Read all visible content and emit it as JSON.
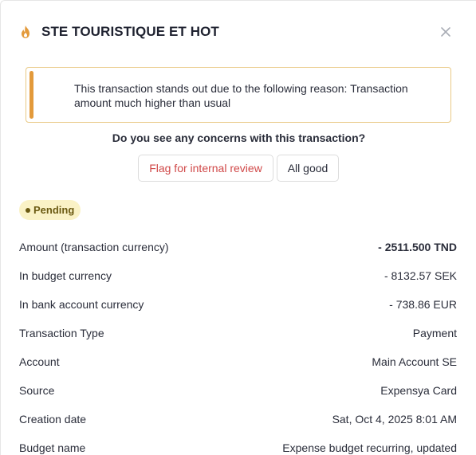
{
  "header": {
    "title": "STE TOURISTIQUE ET HOT"
  },
  "alert": {
    "line1": "This transaction stands out due to the following reason: Transaction",
    "line2": "amount much higher than usual"
  },
  "review": {
    "question": "Do you see any concerns with this transaction?",
    "flag_label": "Flag for internal review",
    "ok_label": "All good"
  },
  "status": {
    "label": "Pending"
  },
  "details": [
    {
      "label": "Amount (transaction currency)",
      "value": "- 2511.500 TND",
      "bold": true
    },
    {
      "label": "In budget currency",
      "value": "- 8132.57 SEK"
    },
    {
      "label": "In bank account currency",
      "value": "- 738.86 EUR"
    },
    {
      "label": "Transaction Type",
      "value": "Payment"
    },
    {
      "label": "Account",
      "value": "Main Account SE"
    },
    {
      "label": "Source",
      "value": "Expensya Card"
    },
    {
      "label": "Creation date",
      "value": "Sat, Oct 4, 2025 8:01 AM"
    },
    {
      "label": "Budget name",
      "value": "Expense budget recurring, updated"
    }
  ],
  "colors": {
    "accent_orange": "#e39a3b",
    "flag_red": "#d04848",
    "pending_bg": "#faf2c6",
    "pending_text": "#6b5a12"
  },
  "icons": {
    "header": "flame-icon",
    "close": "close-icon"
  }
}
